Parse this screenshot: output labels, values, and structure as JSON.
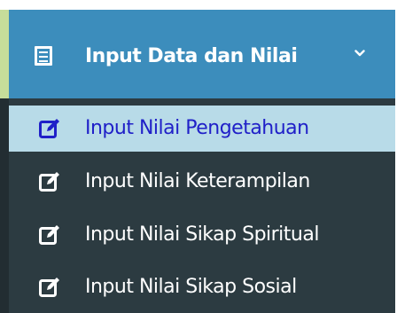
{
  "menu": {
    "header": {
      "label": "Input Data dan Nilai",
      "icon": "list-alt-icon",
      "toggle_icon": "chevron-down-icon",
      "bg_color": "#3c8dbc"
    },
    "items": [
      {
        "label": "Input Nilai Pengetahuan",
        "icon": "edit-icon",
        "active": true
      },
      {
        "label": "Input Nilai Keterampilan",
        "icon": "edit-icon",
        "active": false
      },
      {
        "label": "Input Nilai Sikap Spiritual",
        "icon": "edit-icon",
        "active": false
      },
      {
        "label": "Input Nilai Sikap Sosial",
        "icon": "edit-icon",
        "active": false
      }
    ],
    "colors": {
      "sidebar_bg": "#222d32",
      "submenu_bg": "#2c3b41",
      "active_bg": "#b8dbe8",
      "active_text": "#2020c8",
      "text": "#ffffff",
      "accent": "#c6dd9a"
    }
  }
}
